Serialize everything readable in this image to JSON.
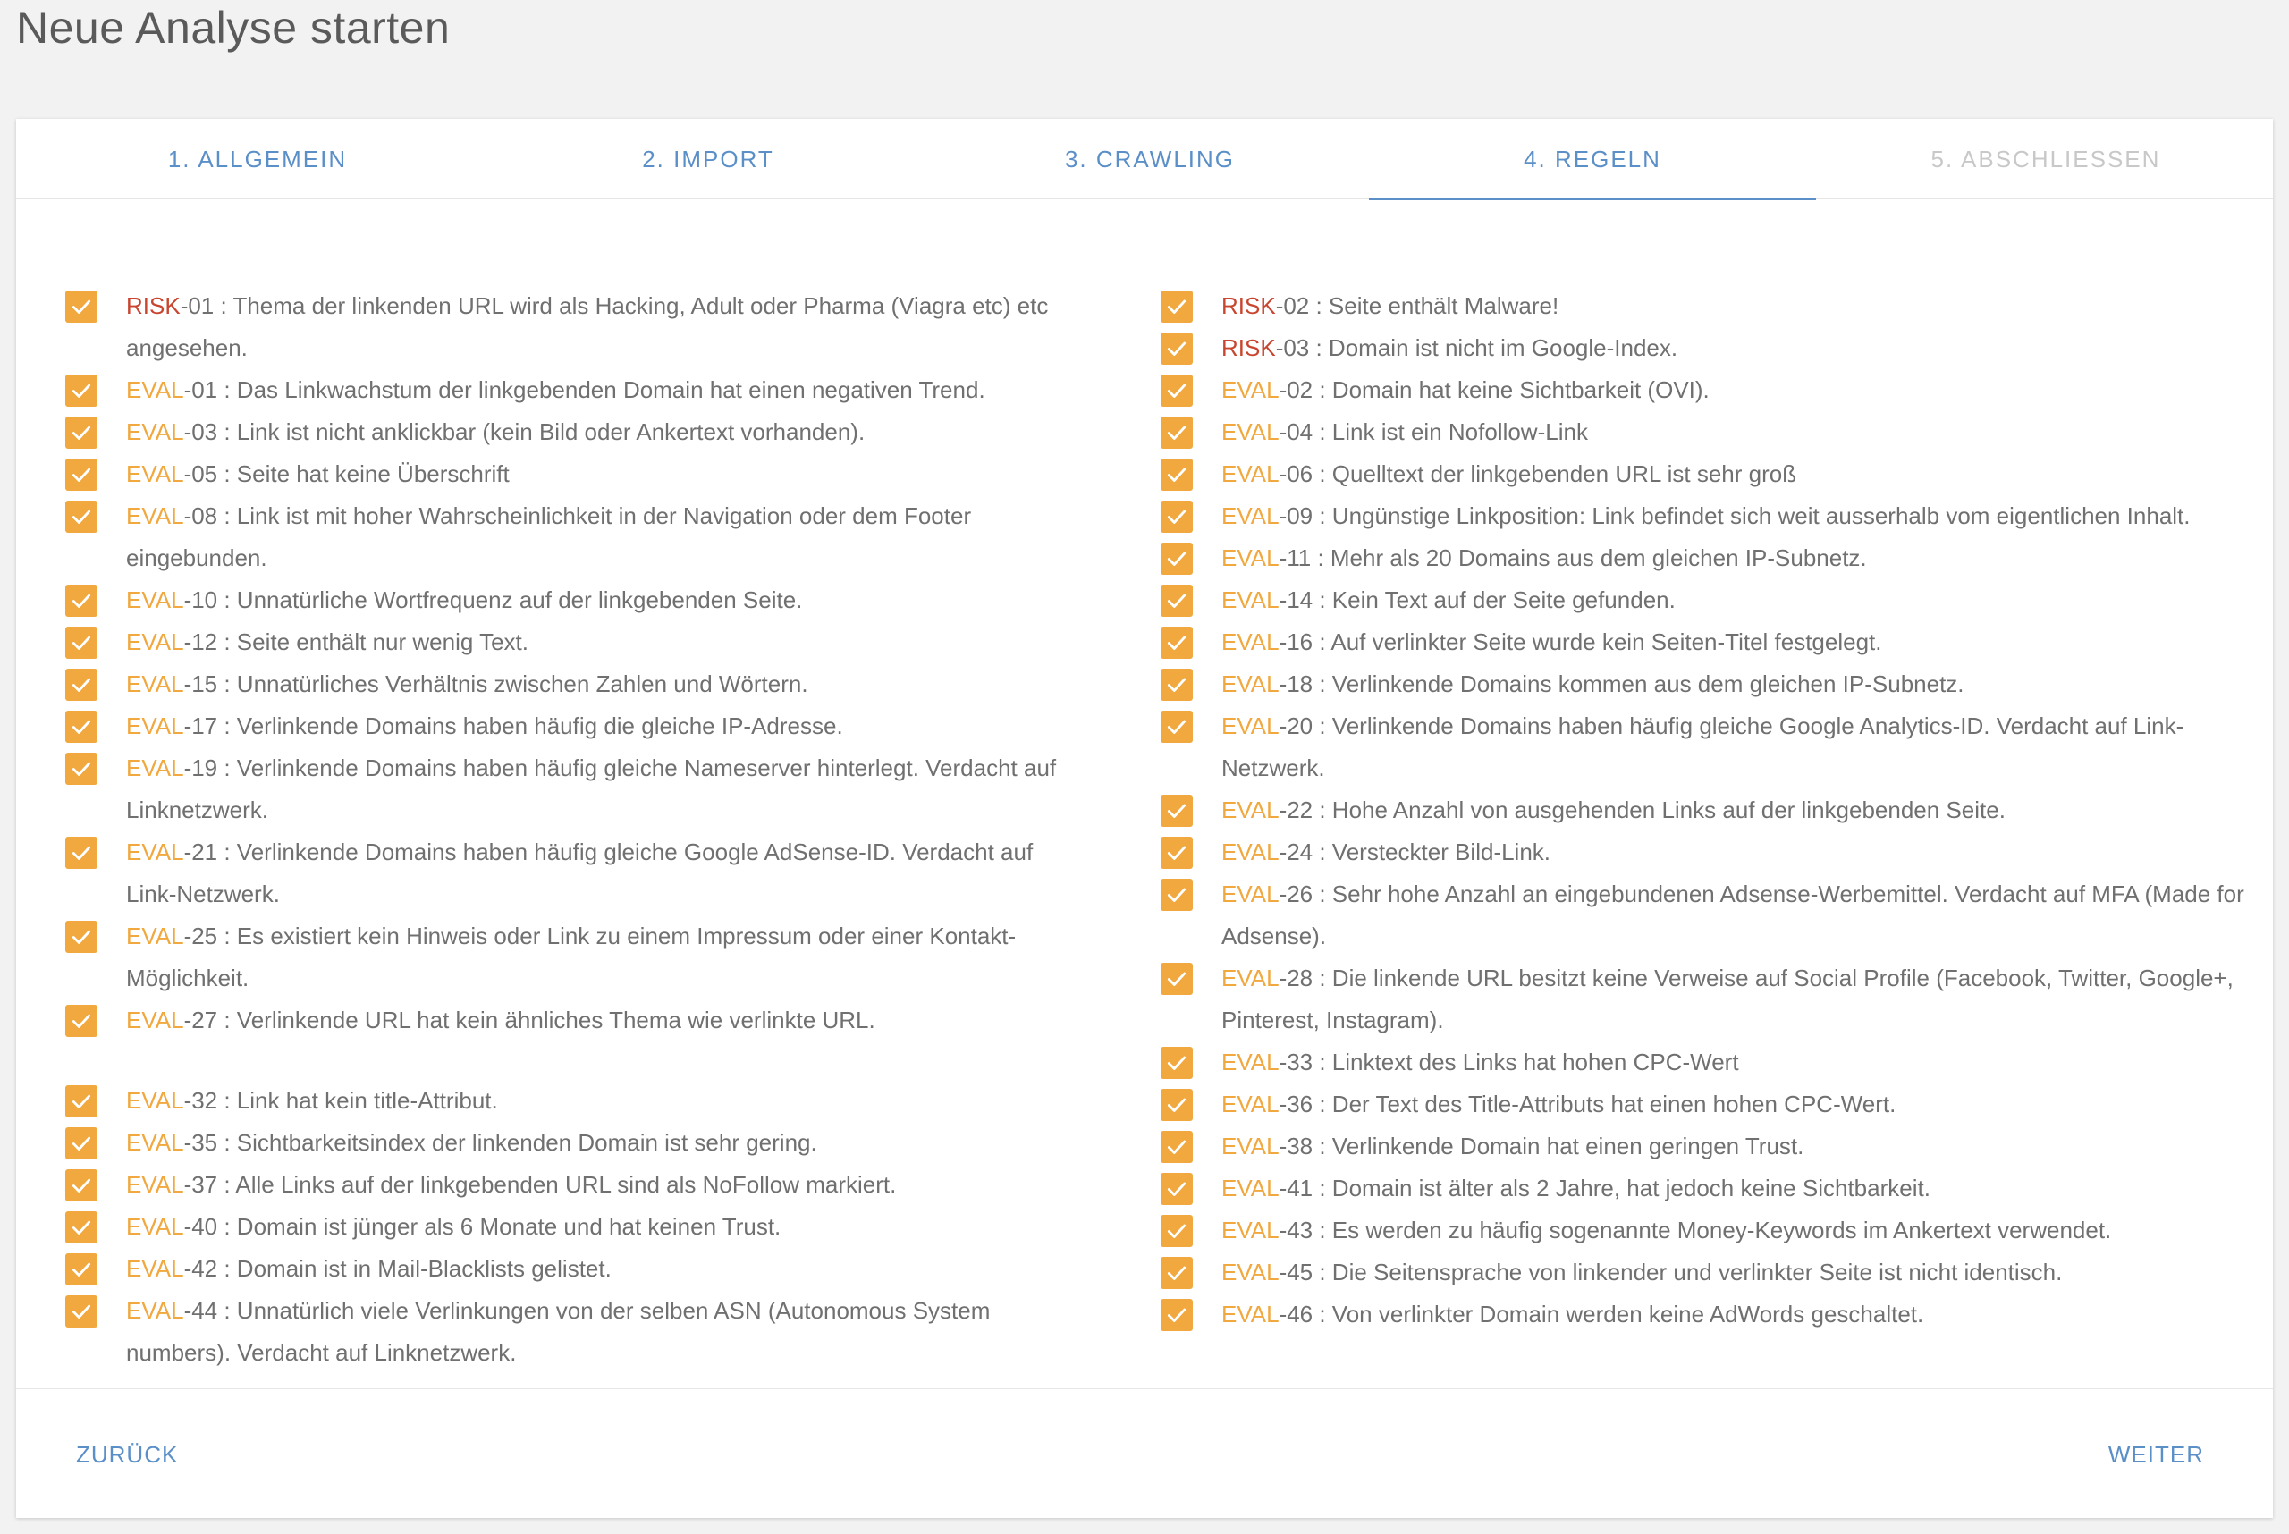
{
  "page": {
    "title": "Neue Analyse starten"
  },
  "tabs": [
    {
      "label": "1. ALLGEMEIN",
      "state": "done"
    },
    {
      "label": "2. IMPORT",
      "state": "done"
    },
    {
      "label": "3. CRAWLING",
      "state": "done"
    },
    {
      "label": "4. REGELN",
      "state": "active"
    },
    {
      "label": "5. ABSCHLIESSEN",
      "state": "disabled"
    }
  ],
  "colors": {
    "accent": "#5b8fc8",
    "checkbox": "#f0a83f",
    "risk": "#c8462f",
    "eval": "#f0a83f"
  },
  "rules_left": [
    {
      "prefix": "RISK",
      "type": "risk",
      "code": "-01",
      "text": " : Thema der linkenden URL wird als Hacking, Adult oder Pharma (Viagra etc) etc angesehen.",
      "checked": true
    },
    {
      "prefix": "EVAL",
      "type": "eval",
      "code": "-01",
      "text": " : Das Linkwachstum der linkgebenden Domain hat einen negativen Trend.",
      "checked": true
    },
    {
      "prefix": "EVAL",
      "type": "eval",
      "code": "-03",
      "text": " : Link ist nicht anklickbar (kein Bild oder Ankertext vorhanden).",
      "checked": true
    },
    {
      "prefix": "EVAL",
      "type": "eval",
      "code": "-05",
      "text": " : Seite hat keine Überschrift",
      "checked": true
    },
    {
      "prefix": "EVAL",
      "type": "eval",
      "code": "-08",
      "text": " : Link ist mit hoher Wahrscheinlichkeit in der Navigation oder dem Footer eingebunden.",
      "checked": true
    },
    {
      "prefix": "EVAL",
      "type": "eval",
      "code": "-10",
      "text": " : Unnatürliche Wortfrequenz auf der linkgebenden Seite.",
      "checked": true
    },
    {
      "prefix": "EVAL",
      "type": "eval",
      "code": "-12",
      "text": " : Seite enthält nur wenig Text.",
      "checked": true
    },
    {
      "prefix": "EVAL",
      "type": "eval",
      "code": "-15",
      "text": " : Unnatürliches Verhältnis zwischen Zahlen und Wörtern.",
      "checked": true
    },
    {
      "prefix": "EVAL",
      "type": "eval",
      "code": "-17",
      "text": " : Verlinkende Domains haben häufig die gleiche IP-Adresse.",
      "checked": true
    },
    {
      "prefix": "EVAL",
      "type": "eval",
      "code": "-19",
      "text": " : Verlinkende Domains haben häufig gleiche Nameserver hinterlegt. Verdacht auf Linknetzwerk.",
      "checked": true
    },
    {
      "prefix": "EVAL",
      "type": "eval",
      "code": "-21",
      "text": " : Verlinkende Domains haben häufig gleiche Google AdSense-ID. Verdacht auf Link-Netzwerk.",
      "checked": true
    },
    {
      "prefix": "EVAL",
      "type": "eval",
      "code": "-25",
      "text": " : Es existiert kein Hinweis oder Link zu einem Impressum oder einer Kontakt-Möglichkeit.",
      "checked": true
    },
    {
      "prefix": "EVAL",
      "type": "eval",
      "code": "-27",
      "text": " : Verlinkende URL hat kein ähnliches Thema wie verlinkte URL.",
      "checked": true
    },
    {
      "prefix": "EVAL",
      "type": "eval",
      "code": "-32",
      "text": " : Link hat kein title-Attribut.",
      "checked": true
    },
    {
      "prefix": "EVAL",
      "type": "eval",
      "code": "-35",
      "text": " : Sichtbarkeitsindex der linkenden Domain ist sehr gering.",
      "checked": true
    },
    {
      "prefix": "EVAL",
      "type": "eval",
      "code": "-37",
      "text": " : Alle Links auf der linkgebenden URL sind als NoFollow markiert.",
      "checked": true
    },
    {
      "prefix": "EVAL",
      "type": "eval",
      "code": "-40",
      "text": " : Domain ist jünger als 6 Monate und hat keinen Trust.",
      "checked": true
    },
    {
      "prefix": "EVAL",
      "type": "eval",
      "code": "-42",
      "text": " : Domain ist in Mail-Blacklists gelistet.",
      "checked": true
    },
    {
      "prefix": "EVAL",
      "type": "eval",
      "code": "-44",
      "text": " : Unnatürlich viele Verlinkungen von der selben ASN (Autonomous System numbers). Verdacht auf Linknetzwerk.",
      "checked": true
    }
  ],
  "rules_right": [
    {
      "prefix": "RISK",
      "type": "risk",
      "code": "-02",
      "text": " : Seite enthält Malware!",
      "checked": true
    },
    {
      "prefix": "RISK",
      "type": "risk",
      "code": "-03",
      "text": " : Domain ist nicht im Google-Index.",
      "checked": true
    },
    {
      "prefix": "EVAL",
      "type": "eval",
      "code": "-02",
      "text": " : Domain hat keine Sichtbarkeit (OVI).",
      "checked": true
    },
    {
      "prefix": "EVAL",
      "type": "eval",
      "code": "-04",
      "text": " : Link ist ein Nofollow-Link",
      "checked": true
    },
    {
      "prefix": "EVAL",
      "type": "eval",
      "code": "-06",
      "text": " : Quelltext der linkgebenden URL ist sehr groß",
      "checked": true
    },
    {
      "prefix": "EVAL",
      "type": "eval",
      "code": "-09",
      "text": " : Ungünstige Linkposition: Link befindet sich weit ausserhalb vom eigentlichen Inhalt.",
      "checked": true
    },
    {
      "prefix": "EVAL",
      "type": "eval",
      "code": "-11",
      "text": " : Mehr als 20 Domains aus dem gleichen IP-Subnetz.",
      "checked": true
    },
    {
      "prefix": "EVAL",
      "type": "eval",
      "code": "-14",
      "text": " : Kein Text auf der Seite gefunden.",
      "checked": true
    },
    {
      "prefix": "EVAL",
      "type": "eval",
      "code": "-16",
      "text": " : Auf verlinkter Seite wurde kein Seiten-Titel festgelegt.",
      "checked": true
    },
    {
      "prefix": "EVAL",
      "type": "eval",
      "code": "-18",
      "text": " : Verlinkende Domains kommen aus dem gleichen IP-Subnetz.",
      "checked": true
    },
    {
      "prefix": "EVAL",
      "type": "eval",
      "code": "-20",
      "text": " : Verlinkende Domains haben häufig gleiche Google Analytics-ID. Verdacht auf Link-Netzwerk.",
      "checked": true
    },
    {
      "prefix": "EVAL",
      "type": "eval",
      "code": "-22",
      "text": " : Hohe Anzahl von ausgehenden Links auf der linkgebenden Seite.",
      "checked": true
    },
    {
      "prefix": "EVAL",
      "type": "eval",
      "code": "-24",
      "text": " : Versteckter Bild-Link.",
      "checked": true
    },
    {
      "prefix": "EVAL",
      "type": "eval",
      "code": "-26",
      "text": " : Sehr hohe Anzahl an eingebundenen Adsense-Werbemittel. Verdacht auf MFA (Made for Adsense).",
      "checked": true
    },
    {
      "prefix": "EVAL",
      "type": "eval",
      "code": "-28",
      "text": " : Die linkende URL besitzt keine Verweise auf Social Profile (Facebook, Twitter, Google+, Pinterest, Instagram).",
      "checked": true
    },
    {
      "prefix": "EVAL",
      "type": "eval",
      "code": "-33",
      "text": " : Linktext des Links hat hohen CPC-Wert",
      "checked": true
    },
    {
      "prefix": "EVAL",
      "type": "eval",
      "code": "-36",
      "text": " : Der Text des Title-Attributs hat einen hohen CPC-Wert.",
      "checked": true
    },
    {
      "prefix": "EVAL",
      "type": "eval",
      "code": "-38",
      "text": " : Verlinkende Domain hat einen geringen Trust.",
      "checked": true
    },
    {
      "prefix": "EVAL",
      "type": "eval",
      "code": "-41",
      "text": " : Domain ist älter als 2 Jahre, hat jedoch keine Sichtbarkeit.",
      "checked": true
    },
    {
      "prefix": "EVAL",
      "type": "eval",
      "code": "-43",
      "text": " : Es werden zu häufig sogenannte Money-Keywords im Ankertext verwendet.",
      "checked": true
    },
    {
      "prefix": "EVAL",
      "type": "eval",
      "code": "-45",
      "text": " : Die Seitensprache von linkender und verlinkter Seite ist nicht identisch.",
      "checked": true
    },
    {
      "prefix": "EVAL",
      "type": "eval",
      "code": "-46",
      "text": " : Von verlinkter Domain werden keine AdWords geschaltet.",
      "checked": true
    }
  ],
  "footer": {
    "back_label": "ZURÜCK",
    "next_label": "WEITER"
  }
}
